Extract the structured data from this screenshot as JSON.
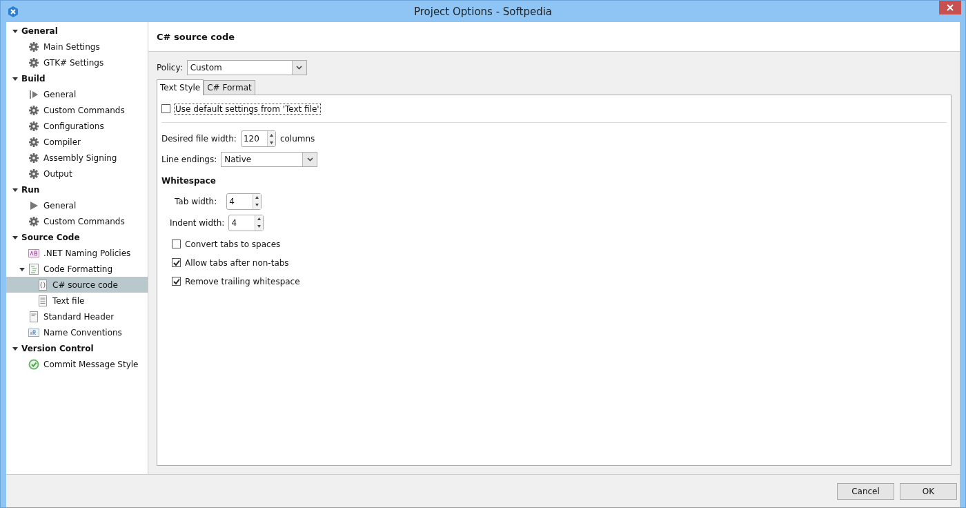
{
  "window": {
    "title": "Project Options - Softpedia"
  },
  "sidebar": {
    "groups": [
      {
        "label": "General",
        "expanded": true,
        "children": [
          {
            "label": "Main Settings",
            "kind": "gear",
            "selected": false
          },
          {
            "label": "GTK# Settings",
            "kind": "gear",
            "selected": false
          }
        ]
      },
      {
        "label": "Build",
        "expanded": true,
        "children": [
          {
            "label": "General",
            "kind": "playbar",
            "selected": false
          },
          {
            "label": "Custom Commands",
            "kind": "gear",
            "selected": false
          },
          {
            "label": "Configurations",
            "kind": "gear",
            "selected": false
          },
          {
            "label": "Compiler",
            "kind": "gear",
            "selected": false
          },
          {
            "label": "Assembly Signing",
            "kind": "gear",
            "selected": false
          },
          {
            "label": "Output",
            "kind": "gear",
            "selected": false
          }
        ]
      },
      {
        "label": "Run",
        "expanded": true,
        "children": [
          {
            "label": "General",
            "kind": "play",
            "selected": false
          },
          {
            "label": "Custom Commands",
            "kind": "gear",
            "selected": false
          }
        ]
      },
      {
        "label": "Source Code",
        "expanded": true,
        "children": [
          {
            "label": ".NET Naming Policies",
            "kind": "ab",
            "selected": false
          },
          {
            "label": "Code Formatting",
            "kind": "format",
            "selected": false,
            "expanded": true,
            "children": [
              {
                "label": "C# source code",
                "kind": "braces",
                "selected": true
              },
              {
                "label": "Text file",
                "kind": "doc",
                "selected": false
              }
            ]
          },
          {
            "label": "Standard Header",
            "kind": "header",
            "selected": false
          },
          {
            "label": "Name Conventions",
            "kind": "ir",
            "selected": false
          }
        ]
      },
      {
        "label": "Version Control",
        "expanded": true,
        "children": [
          {
            "label": "Commit Message Style",
            "kind": "check",
            "selected": false
          }
        ]
      }
    ]
  },
  "page": {
    "title": "C# source code",
    "policy_label": "Policy:",
    "policy_value": "Custom",
    "tabs": [
      {
        "label": "Text Style",
        "selected": true
      },
      {
        "label": "C# Format",
        "selected": false
      }
    ],
    "use_default": {
      "label": "Use default settings from 'Text file'",
      "checked": false
    },
    "file_width": {
      "label": "Desired file width:",
      "value": "120",
      "unit": "columns"
    },
    "line_endings": {
      "label": "Line endings:",
      "value": "Native"
    },
    "whitespace_heading": "Whitespace",
    "tab_width": {
      "label": "Tab width:",
      "value": "4"
    },
    "indent_width": {
      "label": "Indent width:",
      "value": "4"
    },
    "options": [
      {
        "label": "Convert tabs to spaces",
        "checked": false
      },
      {
        "label": "Allow tabs after non-tabs",
        "checked": true
      },
      {
        "label": "Remove trailing whitespace",
        "checked": true
      }
    ]
  },
  "buttons": [
    "Cancel",
    "OK"
  ]
}
